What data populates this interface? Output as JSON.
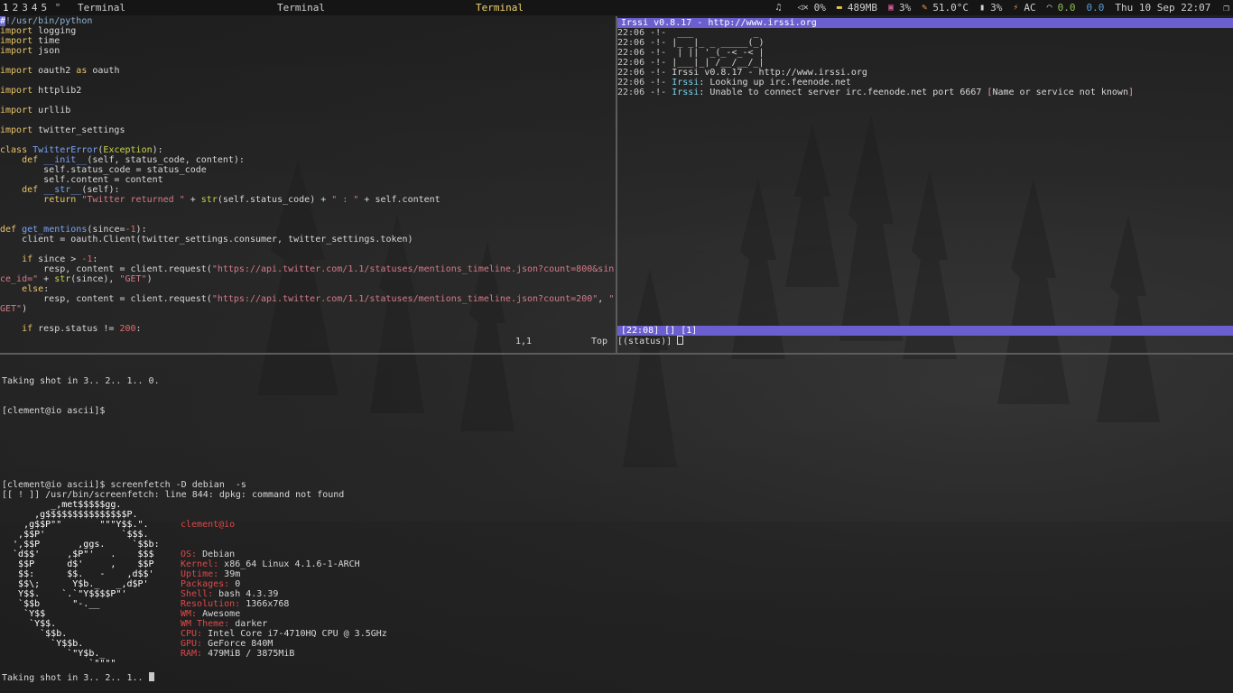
{
  "topbar": {
    "tags": [
      "1",
      "2",
      "3",
      "4",
      "5"
    ],
    "layout_glyph": "▫",
    "titles": [
      "Terminal",
      "Terminal",
      "Terminal"
    ],
    "status": {
      "volume": "0%",
      "memory": "489MB",
      "cpu": "3%",
      "temp": "51.0°C",
      "battery": "3%",
      "power": "AC",
      "net_down": "0.0",
      "net_up": "0.0",
      "clock": "Thu 10 Sep 22:07"
    },
    "icons": {
      "music": "♫",
      "volume": "🔇",
      "memory": "▬",
      "cpu": "▣",
      "temp": "✎",
      "battery": "▮",
      "power": "⚡",
      "wifi": "◠",
      "window": "❐"
    },
    "colors": {
      "active_title": "#f2d26c"
    }
  },
  "vim": {
    "lines": [
      [
        {
          "t": "#",
          "c": "cursor-blk"
        },
        {
          "t": "!/usr/bin/python",
          "c": "cmt"
        }
      ],
      [
        {
          "t": "import",
          "c": "kw"
        },
        {
          "t": " logging"
        }
      ],
      [
        {
          "t": "import",
          "c": "kw"
        },
        {
          "t": " time"
        }
      ],
      [
        {
          "t": "import",
          "c": "kw"
        },
        {
          "t": " json"
        }
      ],
      [
        {
          "t": ""
        }
      ],
      [
        {
          "t": "import",
          "c": "kw"
        },
        {
          "t": " oauth2 "
        },
        {
          "t": "as",
          "c": "kw"
        },
        {
          "t": " oauth"
        }
      ],
      [
        {
          "t": ""
        }
      ],
      [
        {
          "t": "import",
          "c": "kw"
        },
        {
          "t": " httplib2"
        }
      ],
      [
        {
          "t": ""
        }
      ],
      [
        {
          "t": "import",
          "c": "kw"
        },
        {
          "t": " urllib"
        }
      ],
      [
        {
          "t": ""
        }
      ],
      [
        {
          "t": "import",
          "c": "kw"
        },
        {
          "t": " twitter_settings"
        }
      ],
      [
        {
          "t": ""
        }
      ],
      [
        {
          "t": "class",
          "c": "kw"
        },
        {
          "t": " "
        },
        {
          "t": "TwitterError",
          "c": "cls"
        },
        {
          "t": "("
        },
        {
          "t": "Exception",
          "c": "bi"
        },
        {
          "t": "):"
        }
      ],
      [
        {
          "t": "    "
        },
        {
          "t": "def",
          "c": "kw"
        },
        {
          "t": " "
        },
        {
          "t": "__init__",
          "c": "fn"
        },
        {
          "t": "(self, status_code, content):"
        }
      ],
      [
        {
          "t": "        self.status_code = status_code"
        }
      ],
      [
        {
          "t": "        self.content = content"
        }
      ],
      [
        {
          "t": "    "
        },
        {
          "t": "def",
          "c": "kw"
        },
        {
          "t": " "
        },
        {
          "t": "__str__",
          "c": "fn"
        },
        {
          "t": "(self):"
        }
      ],
      [
        {
          "t": "        "
        },
        {
          "t": "return",
          "c": "kw"
        },
        {
          "t": " "
        },
        {
          "t": "\"Twitter returned \"",
          "c": "str"
        },
        {
          "t": " + "
        },
        {
          "t": "str",
          "c": "bi"
        },
        {
          "t": "(self.status_code) + "
        },
        {
          "t": "\" : \"",
          "c": "str"
        },
        {
          "t": " + self.content"
        }
      ],
      [
        {
          "t": ""
        }
      ],
      [
        {
          "t": ""
        }
      ],
      [
        {
          "t": "def",
          "c": "kw"
        },
        {
          "t": " "
        },
        {
          "t": "get_mentions",
          "c": "fn"
        },
        {
          "t": "(since="
        },
        {
          "t": "-1",
          "c": "num"
        },
        {
          "t": "):"
        }
      ],
      [
        {
          "t": "    client = oauth.Client(twitter_settings.consumer, twitter_settings.token)"
        }
      ],
      [
        {
          "t": ""
        }
      ],
      [
        {
          "t": "    "
        },
        {
          "t": "if",
          "c": "kw"
        },
        {
          "t": " since > "
        },
        {
          "t": "-1",
          "c": "num"
        },
        {
          "t": ":"
        }
      ],
      [
        {
          "t": "        resp, content = client.request("
        },
        {
          "t": "\"https://api.twitter.com/1.1/statuses/mentions_timeline.json?count=800&sin",
          "c": "str"
        }
      ],
      [
        {
          "t": "ce_id=\"",
          "c": "str"
        },
        {
          "t": " + "
        },
        {
          "t": "str",
          "c": "bi"
        },
        {
          "t": "(since), "
        },
        {
          "t": "\"GET\"",
          "c": "str"
        },
        {
          "t": ")"
        }
      ],
      [
        {
          "t": "    "
        },
        {
          "t": "else",
          "c": "kw"
        },
        {
          "t": ":"
        }
      ],
      [
        {
          "t": "        resp, content = client.request("
        },
        {
          "t": "\"https://api.twitter.com/1.1/statuses/mentions_timeline.json?count=200\"",
          "c": "str"
        },
        {
          "t": ", "
        },
        {
          "t": "\"",
          "c": "str"
        }
      ],
      [
        {
          "t": "GET\"",
          "c": "str"
        },
        {
          "t": ")"
        }
      ],
      [
        {
          "t": ""
        }
      ],
      [
        {
          "t": "    "
        },
        {
          "t": "if",
          "c": "kw"
        },
        {
          "t": " resp.status != "
        },
        {
          "t": "200",
          "c": "num"
        },
        {
          "t": ":"
        }
      ]
    ],
    "position": "1,1",
    "scroll": "Top"
  },
  "irssi": {
    "topic": "Irssi v0.8.17 - http://www.irssi.org",
    "messages": [
      [
        {
          "t": "22:06 ",
          "c": "dim"
        },
        {
          "t": "-!- ",
          "c": "dim"
        },
        {
          "t": " ___           _"
        }
      ],
      [
        {
          "t": "22:06 ",
          "c": "dim"
        },
        {
          "t": "-!- ",
          "c": "dim"
        },
        {
          "t": "|_ _|_ _ _____(_)"
        }
      ],
      [
        {
          "t": "22:06 ",
          "c": "dim"
        },
        {
          "t": "-!- ",
          "c": "dim"
        },
        {
          "t": " | || '_(_-<_-< |"
        }
      ],
      [
        {
          "t": "22:06 ",
          "c": "dim"
        },
        {
          "t": "-!- ",
          "c": "dim"
        },
        {
          "t": "|___|_| /__/__/_|"
        }
      ],
      [
        {
          "t": "22:06 ",
          "c": "dim"
        },
        {
          "t": "-!- ",
          "c": "dim"
        },
        {
          "t": "Irssi v0.8.17 - http://www.irssi.org"
        }
      ],
      [
        {
          "t": "22:06 ",
          "c": "dim"
        },
        {
          "t": "-!- ",
          "c": "dim"
        },
        {
          "t": "Irssi",
          "c": "irc"
        },
        {
          "t": ": Looking up irc.feenode.net"
        }
      ],
      [
        {
          "t": "22:06 ",
          "c": "dim"
        },
        {
          "t": "-!- ",
          "c": "dim"
        },
        {
          "t": "Irssi",
          "c": "irc"
        },
        {
          "t": ": Unable to connect server irc.feenode.net port 6667 "
        },
        {
          "t": "[",
          "c": "rl"
        },
        {
          "t": "Name or service not known"
        },
        {
          "t": "]",
          "c": "rl"
        }
      ]
    ],
    "statusbar": "[22:08] [] [1]",
    "prompt": "[(status)] "
  },
  "shell": {
    "top_lines": [
      "Taking shot in 3.. 2.. 1.. 0.",
      "[clement@io ascii]$"
    ],
    "command_line": "[clement@io ascii]$ screenfetch -D debian  -s",
    "error_line": "[[ ! ]] /usr/bin/screenfetch: line 844: dpkg: command not found",
    "logo_lines": [
      "         _,met$$$$$gg.",
      "      ,g$$$$$$$$$$$$$$$P.",
      "    ,g$$P\"\"       \"\"\"Y$$.\".",
      "   ,$$P'              `$$$.",
      "  ',$$P       ,ggs.     `$$b:",
      "  `d$$'     ,$P\"'   .    $$$",
      "   $$P      d$'     ,    $$P",
      "   $$:      $$.   -    ,d$$'",
      "   $$\\;      Y$b._   _,d$P'",
      "   Y$$.    `.`\"Y$$$$P\"'",
      "   `$$b      \"-.__",
      "    `Y$$",
      "     `Y$$.",
      "       `$$b.",
      "         `Y$$b.",
      "            `\"Y$b._",
      "                `\"\"\"\""
    ],
    "info": {
      "user": "clement@io",
      "rows": [
        {
          "k": "OS:",
          "v": " Debian"
        },
        {
          "k": "Kernel:",
          "v": " x86_64 Linux 4.1.6-1-ARCH"
        },
        {
          "k": "Uptime:",
          "v": " 39m"
        },
        {
          "k": "Packages:",
          "v": " 0"
        },
        {
          "k": "Shell:",
          "v": " bash 4.3.39"
        },
        {
          "k": "Resolution:",
          "v": " 1366x768"
        },
        {
          "k": "WM:",
          "v": " Awesome"
        },
        {
          "k": "WM Theme:",
          "v": " darker"
        },
        {
          "k": "CPU:",
          "v": " Intel Core i7-4710HQ CPU @ 3.5GHz"
        },
        {
          "k": "GPU:",
          "v": " GeForce 840M"
        },
        {
          "k": "RAM:",
          "v": " 479MiB / 3875MiB"
        }
      ]
    },
    "last_line": "Taking shot in 3.. 2.. 1.. "
  }
}
